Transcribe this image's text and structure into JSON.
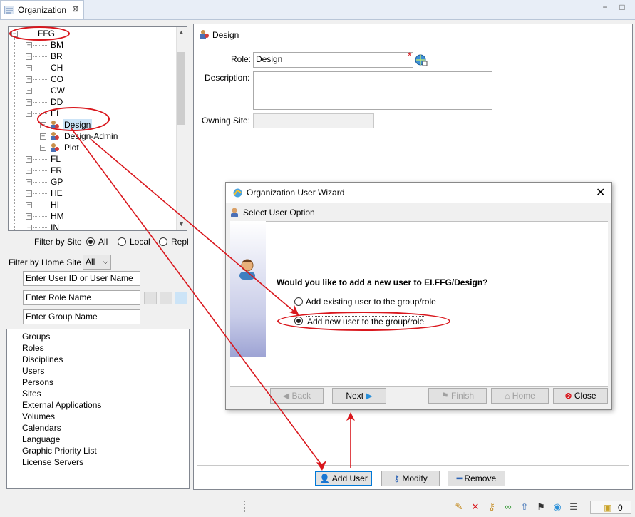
{
  "tab": {
    "title": "Organization",
    "close": "⊠"
  },
  "window_controls": {
    "minimize": "−",
    "restore": "□"
  },
  "tree": {
    "root": "FFG",
    "sites": [
      "BM",
      "BR",
      "CH",
      "CO",
      "CW",
      "DD",
      "EI"
    ],
    "ei_children": [
      "Design",
      "Design-Admin",
      "Plot"
    ],
    "sites_after": [
      "FL",
      "FR",
      "GP",
      "HE",
      "HI",
      "HM",
      "IN"
    ],
    "selected": "Design"
  },
  "filters": {
    "filter_by_site_label": "Filter by Site",
    "site_options": [
      "All",
      "Local",
      "Repl"
    ],
    "site_selected": "All",
    "filter_by_home_site_label": "Filter by Home Site",
    "home_site_value": "All",
    "user_placeholder": "Enter User ID or User Name",
    "role_placeholder": "Enter Role Name",
    "group_placeholder": "Enter Group Name"
  },
  "categories": [
    "Groups",
    "Roles",
    "Disciplines",
    "Users",
    "Persons",
    "Sites",
    "External Applications",
    "Volumes",
    "Calendars",
    "Language",
    "Graphic Priority List",
    "License Servers"
  ],
  "detail": {
    "header": "Design",
    "role_label": "Role:",
    "role_value": "Design",
    "required_mark": "*",
    "description_label": "Description:",
    "description_value": "",
    "owning_site_label": "Owning Site:",
    "owning_site_value": ""
  },
  "bottom_buttons": {
    "add_user": "Add User",
    "modify": "Modify",
    "remove": "Remove"
  },
  "dialog": {
    "title": "Organization User Wizard",
    "step": "Select User Option",
    "question": "Would you like to add a new user to EI.FFG/Design?",
    "option_existing": "Add existing user to the group/role",
    "option_new": "Add new user to the group/role",
    "selected_option": "new",
    "buttons": {
      "back": "Back",
      "next": "Next",
      "finish": "Finish",
      "home": "Home",
      "close": "Close"
    }
  },
  "status": {
    "count": "0"
  },
  "colors": {
    "accent": "#0078d7",
    "annotation": "#d9161c",
    "selection": "#cce4f7"
  }
}
